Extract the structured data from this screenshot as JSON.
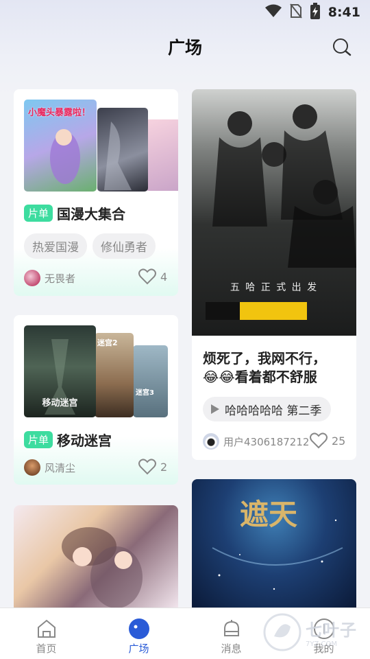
{
  "status_bar": {
    "time": "8:41",
    "icons": [
      "wifi-icon",
      "no-sim-icon",
      "battery-charging-icon"
    ]
  },
  "header": {
    "title": "广场",
    "search_icon": "search-icon"
  },
  "feed": {
    "left": [
      {
        "type": "playlist",
        "badge": "片单",
        "title": "国漫大集合",
        "cover_caption": "小魔头暴露啦！",
        "tags": [
          "热爱国漫",
          "修仙勇者"
        ],
        "user": "无畏者",
        "likes": "4"
      },
      {
        "type": "playlist",
        "badge": "片单",
        "title": "移动迷宫",
        "cover_caption": "移动迷宫",
        "cover_side_labels": [
          "迷宫2",
          "迷宫3"
        ],
        "user": "风清尘",
        "likes": "2"
      },
      {
        "type": "image"
      }
    ],
    "right": [
      {
        "type": "post",
        "poster_caption": "五 哈 正 式 出 发",
        "title_line1": "烦死了，我网不行，",
        "title_line2": "😂😂看着都不舒服",
        "episode": "哈哈哈哈哈 第二季",
        "user": "用户4306187212",
        "likes": "25"
      },
      {
        "type": "image",
        "poster_caption": "遮天"
      }
    ]
  },
  "bottom_nav": [
    {
      "label": "首页",
      "icon": "home-icon",
      "active": false
    },
    {
      "label": "广场",
      "icon": "plaza-icon",
      "active": true
    },
    {
      "label": "消息",
      "icon": "bell-icon",
      "active": false
    },
    {
      "label": "我的",
      "icon": "profile-icon",
      "active": false
    }
  ],
  "watermark": {
    "text": "七叶子",
    "sub": "7YZ.COM"
  },
  "colors": {
    "accent": "#2a5bd7",
    "badge": "#3ddc9f",
    "background": "#f2f3f7"
  }
}
